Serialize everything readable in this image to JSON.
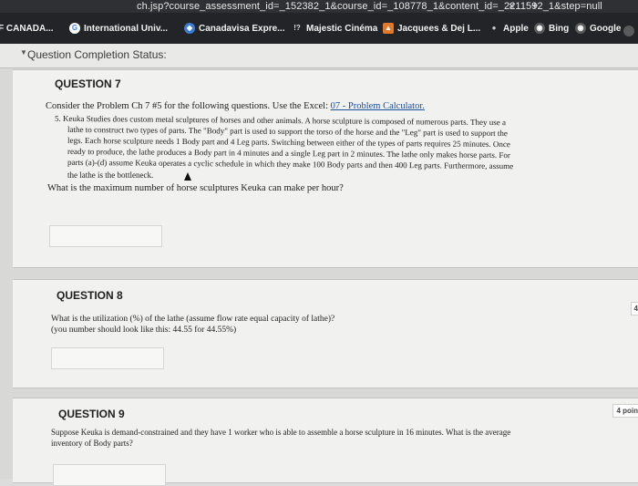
{
  "browser": {
    "url_fragment": "ch.jsp?course_assessment_id=_152382_1&course_id=_108778_1&content_id=_2211592_1&step=null",
    "tab_close": "×",
    "tab_new": "+",
    "bookmarks": [
      {
        "label": "F CANADA..."
      },
      {
        "label": "International Univ..."
      },
      {
        "label": "Canadavisa Expre..."
      },
      {
        "label": "Majestic Cinéma"
      },
      {
        "label": "Jacquees & Dej L..."
      },
      {
        "label": "Apple"
      },
      {
        "label": "Bing"
      },
      {
        "label": "Google"
      }
    ]
  },
  "page": {
    "status_label": "Question Completion Status:",
    "q7": {
      "title": "QUESTION 7",
      "intro_prefix": "Consider the Problem Ch 7 #5 for the following questions. Use the Excel: ",
      "link": "07 - Problem Calculator.",
      "problem_lines": [
        "5. Keuka Studies does custom metal sculptures of horses and other animals. A horse sculpture is composed of numerous parts. They use a",
        "lathe to construct two types of parts. The \"Body\" part is used to support the torso of the horse and the \"Leg\" part is used to support the",
        "legs. Each horse sculpture needs 1 Body part and 4 Leg parts. Switching between either of the types of parts requires 25 minutes. Once",
        "ready to produce, the lathe produces a Body part in 4 minutes and a single Leg part in 2 minutes. The lathe only makes horse parts. For",
        "parts (a)-(d) assume Keuka operates a cyclic schedule in which they make 100 Body parts and then 400 Leg parts. Furthermore, assume",
        "the lathe is the bottleneck."
      ],
      "question": "What is the maximum number of horse sculptures Keuka can make per hour?"
    },
    "q8": {
      "title": "QUESTION 8",
      "line1": "What is the utilization (%) of the lathe (assume flow rate equal capacity of lathe)?",
      "line2": "(you number should look like this: 44.55 for 44.55%)",
      "points_partial": "4"
    },
    "q9": {
      "title": "QUESTION 9",
      "line1": "Suppose Keuka is demand-constrained and they have 1 worker who is able to assemble a horse sculpture in 16 minutes. What is the average",
      "line2": "inventory of Body parts?",
      "points": "4 poin"
    }
  }
}
